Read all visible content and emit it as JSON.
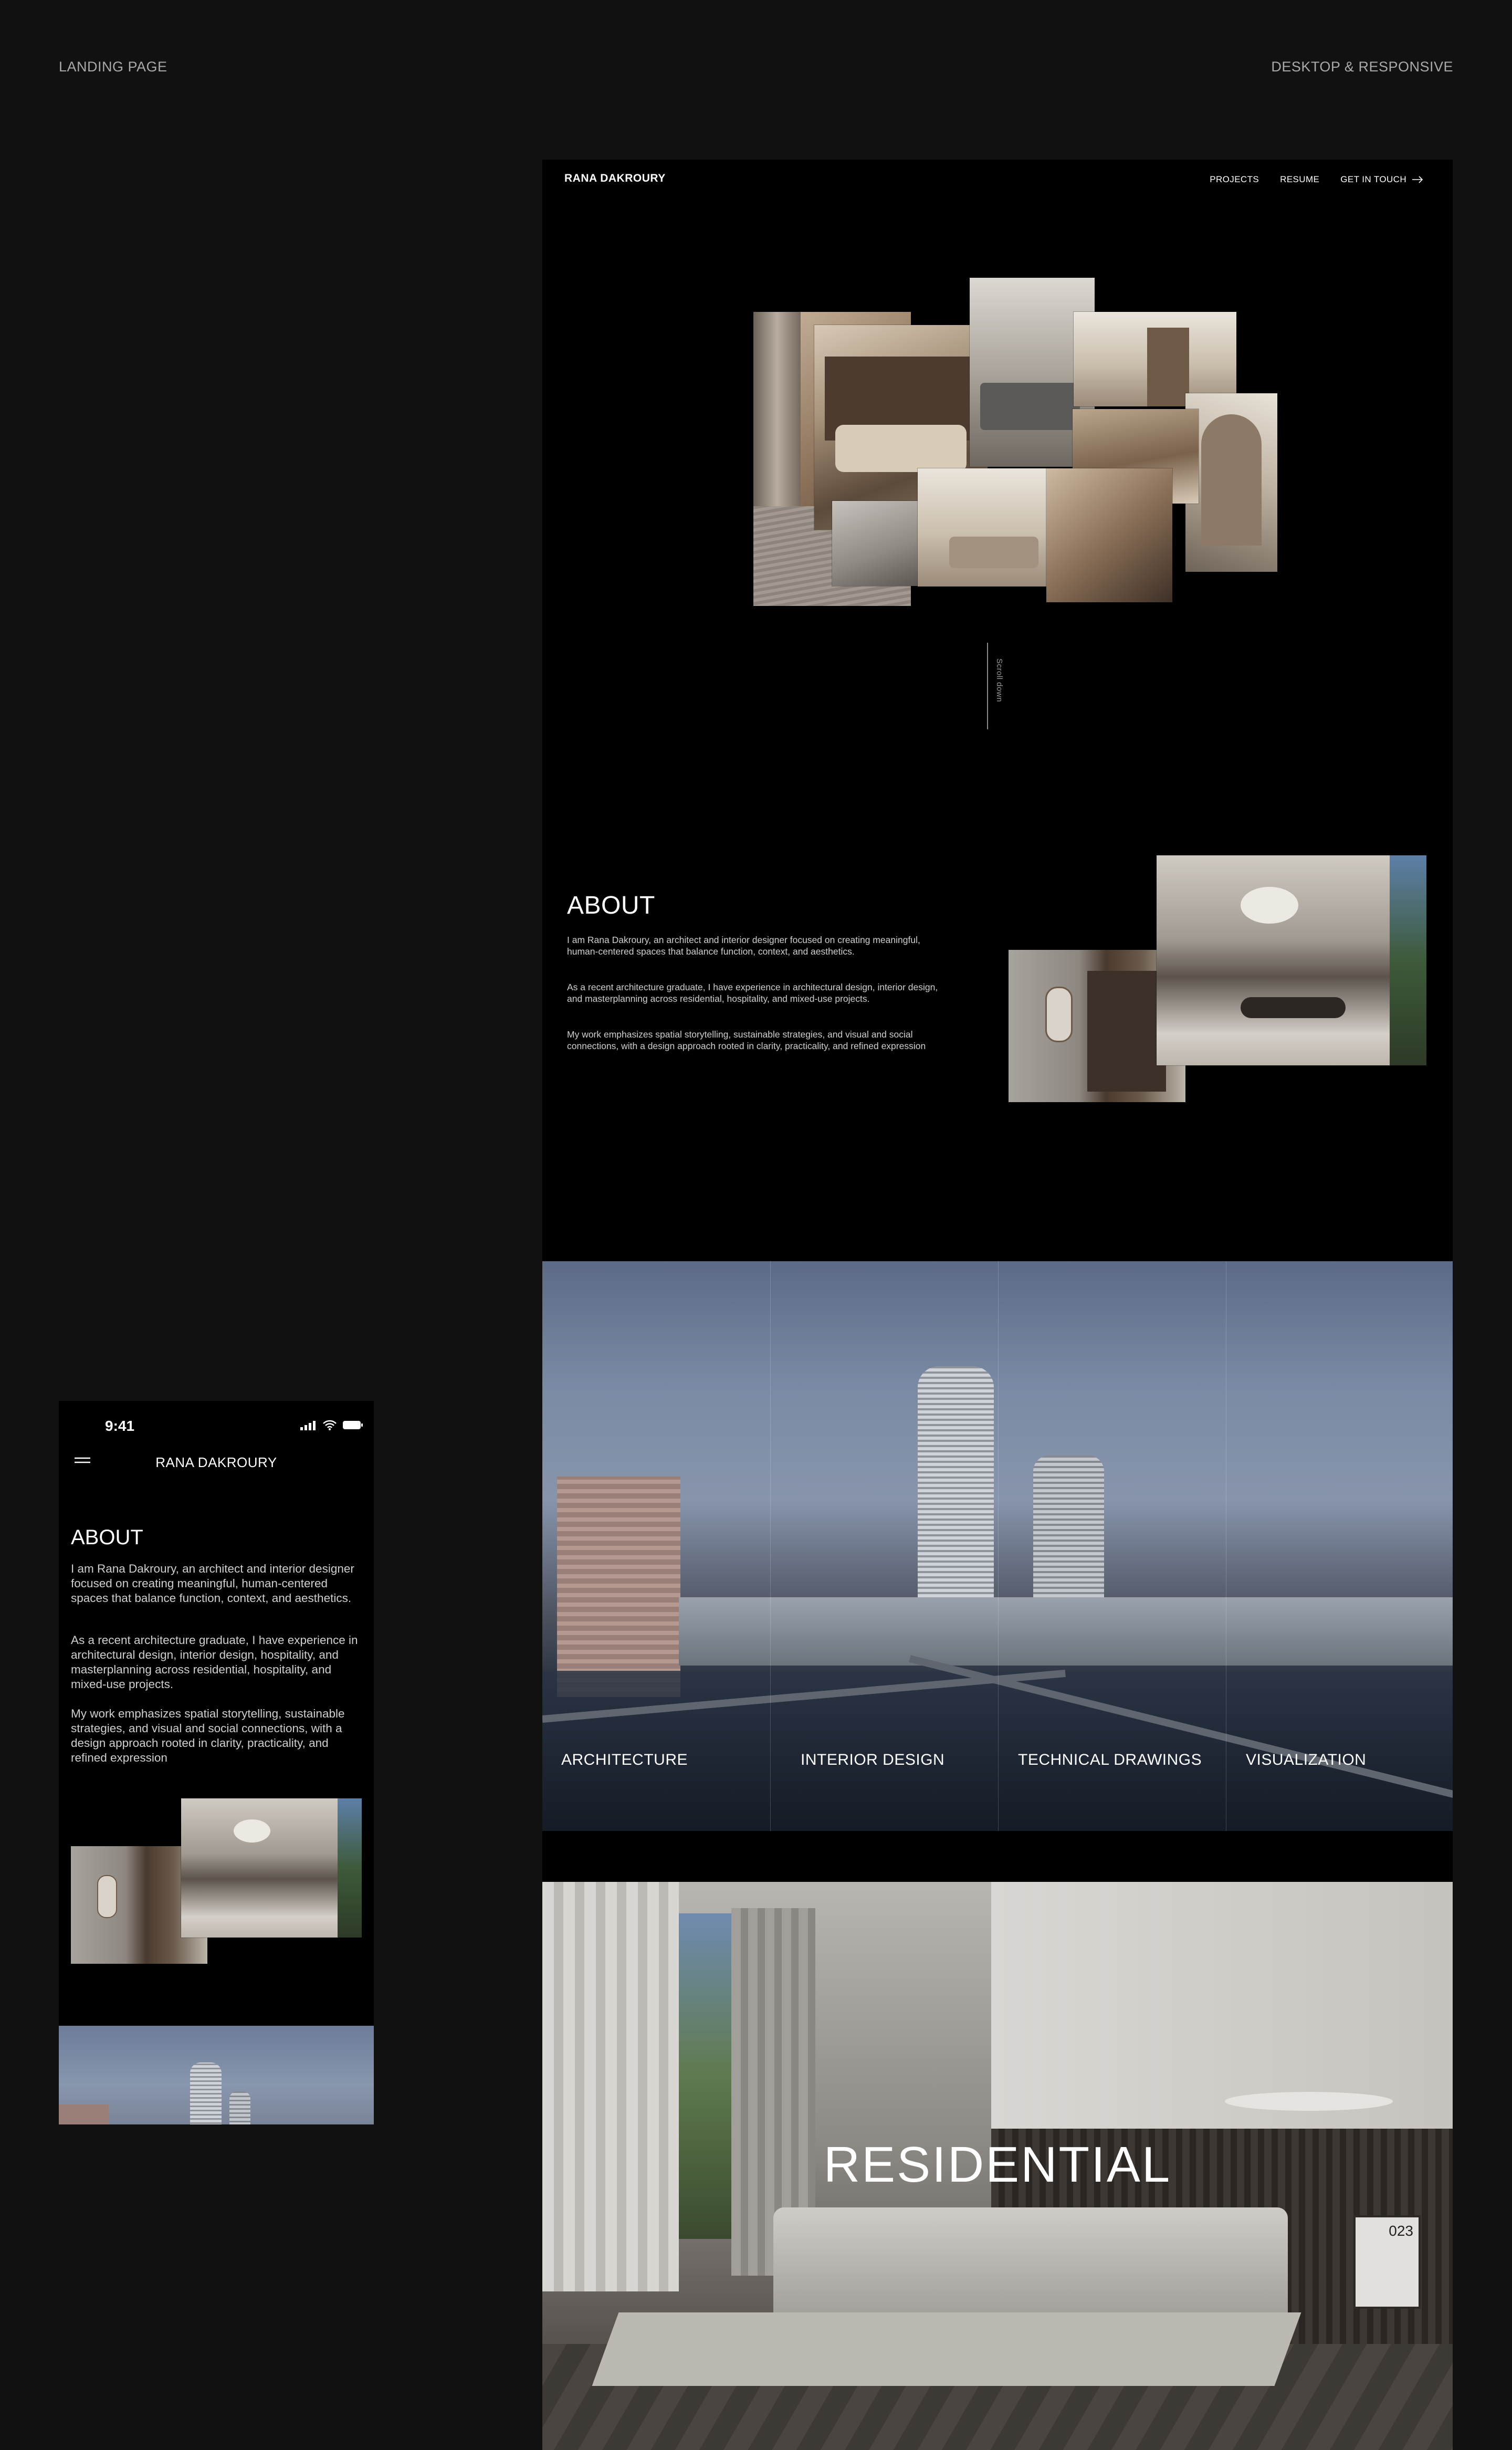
{
  "labels": {
    "left": "LANDING PAGE",
    "right": "DESKTOP & RESPONSIVE"
  },
  "desktop": {
    "brand": "RANA DAKROURY",
    "nav": {
      "projects": "PROJECTS",
      "resume": "RESUME",
      "contact": "GET IN TOUCH"
    },
    "scroll_hint": "Scroll down",
    "about": {
      "title": "ABOUT",
      "paragraphs": [
        "I am Rana Dakroury, an architect and interior designer focused on creating meaningful, human-centered spaces that balance function, context, and aesthetics.",
        "As a recent architecture graduate, I have experience in architectural design, interior design, and masterplanning across residential, hospitality, and mixed-use projects.",
        "My work emphasizes spatial storytelling, sustainable strategies, and visual and social connections, with a design approach rooted in clarity, practicality, and refined expression"
      ]
    },
    "services": [
      "ARCHITECTURE",
      "INTERIOR DESIGN",
      "TECHNICAL DRAWINGS",
      "VISUALIZATION"
    ],
    "residential_title": "RESIDENTIAL",
    "residential_badge": "023"
  },
  "mobile": {
    "time": "9:41",
    "brand": "RANA DAKROURY",
    "about": {
      "title": "ABOUT",
      "paragraphs": [
        "I am Rana Dakroury, an architect and interior designer focused on creating meaningful, human-centered spaces that balance function, context, and aesthetics.",
        "As a recent architecture graduate, I have experience in architectural design, interior design, hospitality, and masterplanning across residential, hospitality, and mixed-use projects.",
        "My work emphasizes spatial storytelling, sustainable strategies, and visual and social connections, with a design approach rooted in clarity, practicality, and refined expression"
      ]
    }
  },
  "colors": {
    "page_bg": "#111111",
    "frame_bg": "#000000",
    "text": "#ffffff",
    "muted": "#a9a9a9"
  }
}
